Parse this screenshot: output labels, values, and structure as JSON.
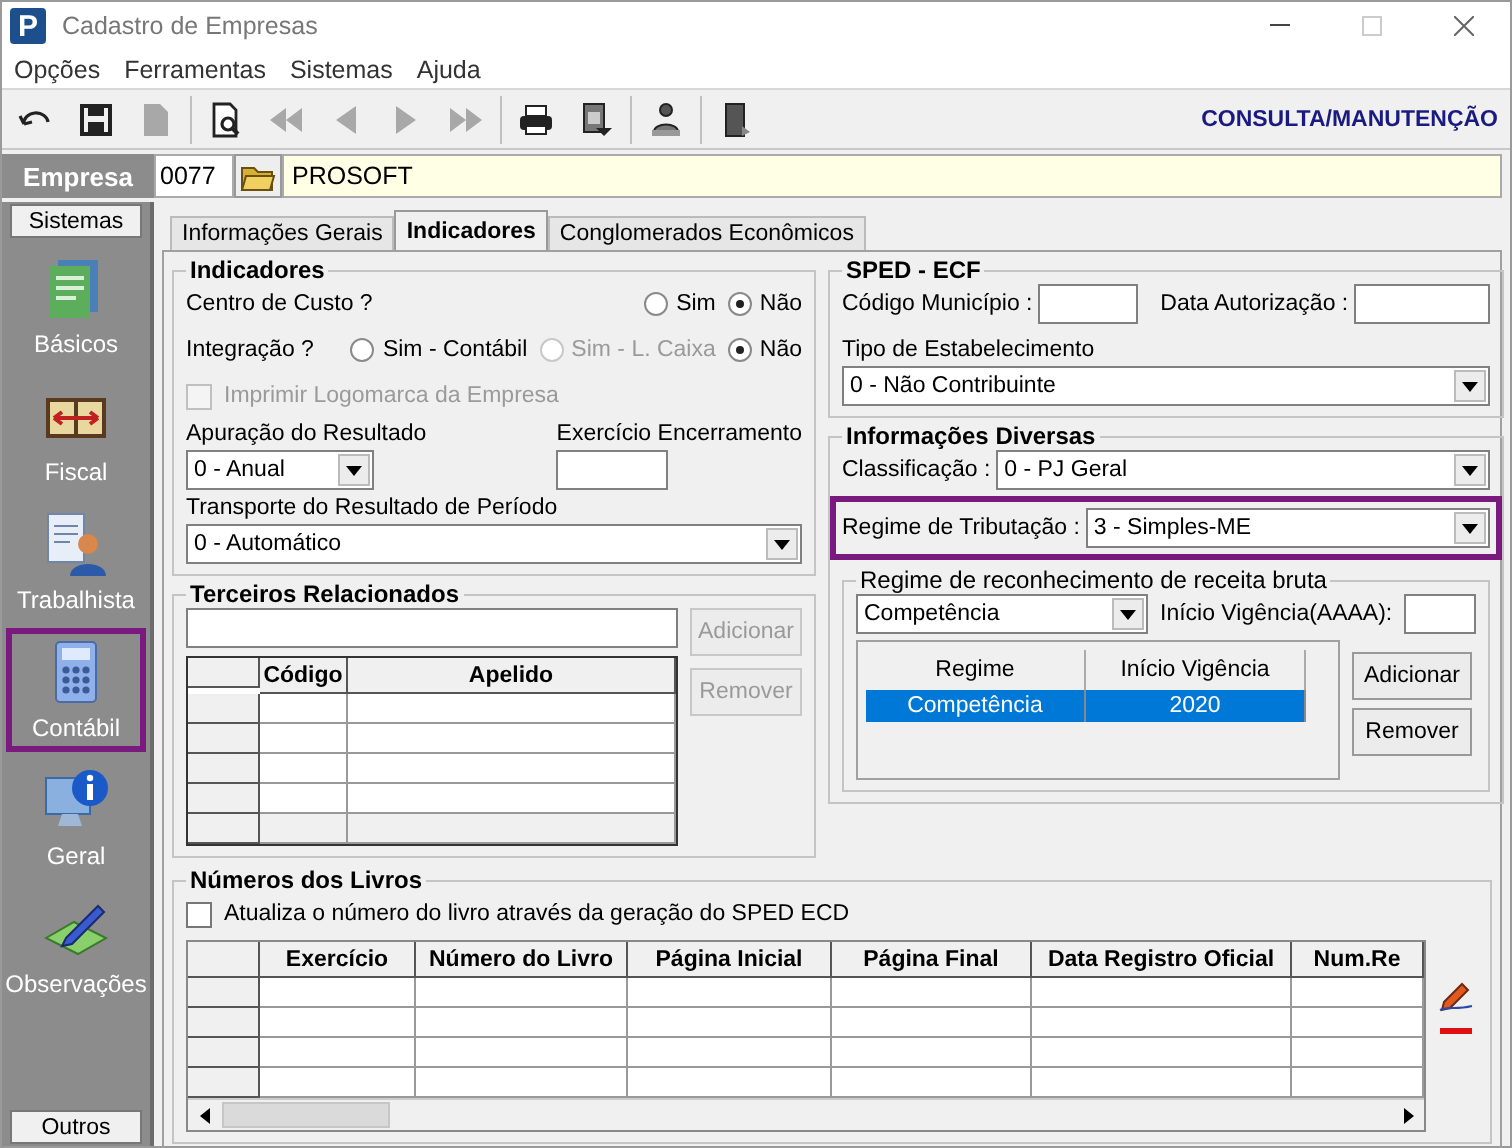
{
  "window": {
    "logo": "P",
    "title": "Cadastro de Empresas"
  },
  "menu": [
    "Opções",
    "Ferramentas",
    "Sistemas",
    "Ajuda"
  ],
  "toolbar": {
    "groups": [
      [
        {
          "kind": "undo",
          "disabled": false
        },
        {
          "kind": "save",
          "disabled": false
        },
        {
          "kind": "delete",
          "disabled": true
        }
      ],
      [
        {
          "kind": "preview",
          "disabled": false
        },
        {
          "kind": "first",
          "disabled": true
        },
        {
          "kind": "prev",
          "disabled": true
        },
        {
          "kind": "next",
          "disabled": true
        },
        {
          "kind": "last",
          "disabled": true
        }
      ],
      [
        {
          "kind": "print",
          "disabled": false
        },
        {
          "kind": "report",
          "disabled": false
        }
      ],
      [
        {
          "kind": "person",
          "disabled": false
        }
      ],
      [
        {
          "kind": "exit",
          "disabled": false
        }
      ]
    ],
    "mode": "CONSULTA/MANUTENÇÃO"
  },
  "company": {
    "label": "Empresa",
    "code": "0077",
    "name": "PROSOFT"
  },
  "sidebar": {
    "header": "Sistemas",
    "items": [
      {
        "kind": "basicos",
        "label": "Básicos",
        "selected": false
      },
      {
        "kind": "fiscal",
        "label": "Fiscal",
        "selected": false
      },
      {
        "kind": "trabalhista",
        "label": "Trabalhista",
        "selected": false
      },
      {
        "kind": "contabil",
        "label": "Contábil",
        "selected": true
      },
      {
        "kind": "geral",
        "label": "Geral",
        "selected": false
      },
      {
        "kind": "observacoes",
        "label": "Observações",
        "selected": false
      }
    ],
    "footer": "Outros"
  },
  "tabs": [
    {
      "label": "Informações Gerais",
      "selected": false
    },
    {
      "label": "Indicadores",
      "selected": true
    },
    {
      "label": "Conglomerados Econômicos",
      "selected": false
    }
  ],
  "indicadores": {
    "title": "Indicadores",
    "centro_custo": {
      "label": "Centro de Custo ?",
      "options": [
        {
          "label": "Sim",
          "selected": false,
          "disabled": false
        },
        {
          "label": "Não",
          "selected": true,
          "disabled": false
        }
      ]
    },
    "integracao": {
      "label": "Integração ?",
      "options": [
        {
          "label": "Sim - Contábil",
          "selected": false,
          "disabled": false
        },
        {
          "label": "Sim - L. Caixa",
          "selected": false,
          "disabled": true
        },
        {
          "label": "Não",
          "selected": true,
          "disabled": false
        }
      ]
    },
    "logo_option": {
      "label": "Imprimir Logomarca da Empresa",
      "checked": false,
      "disabled": true
    },
    "apuracao": {
      "label": "Apuração do Resultado",
      "value": "0 - Anual"
    },
    "exercicio": {
      "label": "Exercício Encerramento"
    },
    "transporte": {
      "label": "Transporte do Resultado de Período",
      "value": "0 - Automático"
    }
  },
  "terceiros": {
    "title": "Terceiros Relacionados",
    "columns": [
      "Código",
      "Apelido"
    ],
    "buttons": [
      {
        "label": "Adicionar",
        "disabled": true
      },
      {
        "label": "Remover",
        "disabled": true
      }
    ]
  },
  "sped": {
    "title": "SPED - ECF",
    "codigo_municipio": {
      "label": "Código Município :"
    },
    "data_autorizacao": {
      "label": "Data Autorização :"
    },
    "tipo": {
      "label": "Tipo de Estabelecimento",
      "value": "0 - Não Contribuinte"
    }
  },
  "diversas": {
    "title": "Informações Diversas",
    "classificacao": {
      "label": "Classificação :",
      "value": "0 - PJ Geral"
    },
    "regime": {
      "label": "Regime de Tributação :",
      "value": "3 - Simples-ME",
      "highlighted": true
    },
    "receita": {
      "title": "Regime de reconhecimento de receita bruta",
      "value": "Competência",
      "inicio": {
        "label": "Início Vigência(AAAA):"
      },
      "columns": [
        "Regime",
        "Início Vigência"
      ],
      "rows": [
        {
          "cells": [
            "Competência",
            "2020"
          ],
          "selected": true
        }
      ],
      "buttons": [
        {
          "label": "Adicionar",
          "disabled": false
        },
        {
          "label": "Remover",
          "disabled": false
        }
      ]
    }
  },
  "livros": {
    "title": "Números dos Livros",
    "sped_option": {
      "label": "Atualiza o número do livro através da geração do SPED ECD",
      "checked": false
    },
    "columns": [
      "Exercício",
      "Número do Livro",
      "Página Inicial",
      "Página Final",
      "Data Registro Oficial",
      "Num.Re"
    ]
  }
}
